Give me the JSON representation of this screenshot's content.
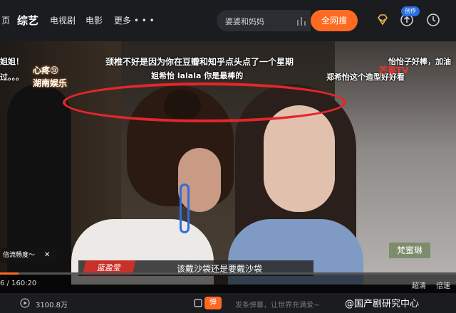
{
  "nav": {
    "items": [
      {
        "label": "页",
        "active": false
      },
      {
        "label": "综艺",
        "active": true
      },
      {
        "label": "电视剧",
        "active": false
      },
      {
        "label": "电影",
        "active": false
      },
      {
        "label": "更多 • • •",
        "active": false
      }
    ]
  },
  "search": {
    "query": "婆婆和妈妈",
    "button_label": "全网搜"
  },
  "header_icons": {
    "vip": "diamond-icon",
    "upload": "upload-icon",
    "upload_badge": "创作",
    "history": "clock-icon"
  },
  "video": {
    "danmaku": [
      "颈椎不好是因为你在豆瓣和知乎点头点了一个星期",
      "姐姐！",
      "过。。。",
      "怡怡子好棒，加油",
      "郑希怡这个造型好好看",
      "姐希怡 lalala 你是最棒的"
    ],
    "logo_left_1": "心疼😢",
    "logo_left_2": "湖南娱乐",
    "logo_right": "芒果TV",
    "name_tag_right": "梵蜜琳",
    "subtitle_name": "蓝盈莹",
    "subtitle_text": "该戴沙袋还是要戴沙袋"
  },
  "player": {
    "fluency_tip": "倍流畅度～",
    "current_time": "6",
    "total_time": "160:20",
    "progress_fraction": 0.04,
    "quality_label": "超清",
    "speed_label": "倍速"
  },
  "bottom": {
    "plays": "3100.8万",
    "danmu_button": "弹",
    "danmu_placeholder": "发条弹幕，让世界充满爱~",
    "watermark": "@国产剧研究中心"
  },
  "colors": {
    "accent": "#ff6a22",
    "ring": "#e5262b",
    "subtitle_name_bg": "#c8312a"
  }
}
